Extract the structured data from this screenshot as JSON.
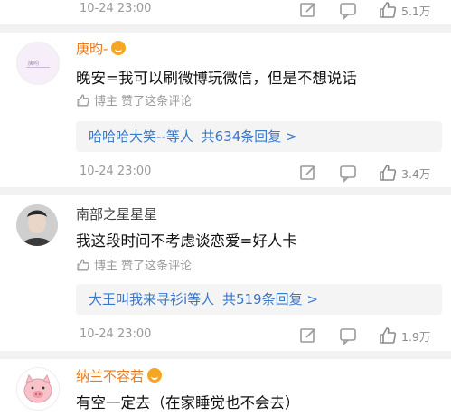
{
  "comments": [
    {
      "time": "10-24 23:00",
      "actions": {
        "edit_icon": "square-edit",
        "comment_icon": "speech-bubble",
        "like_icon": "thumbs-up",
        "like_count": "5.1万"
      }
    },
    {
      "author": "庚昀-",
      "author_style": "vip",
      "text": "晚安=我可以刷微博玩微信，但是不想说话",
      "liked_by": "博主 赞了这条评论",
      "reply_summary": {
        "names": "哈哈哈大笑--等人",
        "count": "共634条回复 >"
      },
      "time": "10-24 23:00",
      "actions": {
        "edit_icon": "square-edit",
        "comment_icon": "speech-bubble",
        "like_icon": "thumbs-up",
        "like_count": "3.4万"
      }
    },
    {
      "author": "南部之星星星",
      "author_style": "plain",
      "text": "我这段时间不考虑谈恋爱=好人卡",
      "liked_by": "博主 赞了这条评论",
      "reply_summary": {
        "names": "大王叫我来寻衫i等人",
        "count": "共519条回复 >"
      },
      "time": "10-24 23:00",
      "actions": {
        "edit_icon": "square-edit",
        "comment_icon": "speech-bubble",
        "like_icon": "thumbs-up",
        "like_count": "1.9万"
      }
    },
    {
      "author": "纳兰不容若",
      "author_style": "vip",
      "text": "有空一定去（在家睡觉也不会去）"
    }
  ],
  "colors": {
    "vip_name": "#e87b1e",
    "link": "#3a78c9",
    "meta": "#9a9a9a"
  }
}
